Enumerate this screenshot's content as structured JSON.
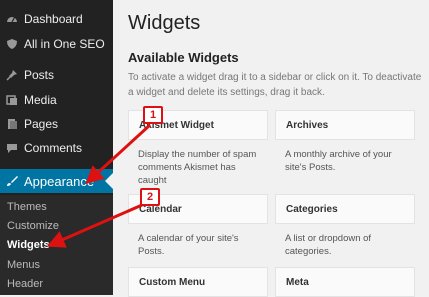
{
  "sidebar": {
    "items": [
      {
        "label": "Dashboard",
        "icon": "dashboard-icon"
      },
      {
        "label": "All in One SEO",
        "icon": "shield-icon"
      },
      {
        "label": "Posts",
        "icon": "pin-icon"
      },
      {
        "label": "Media",
        "icon": "media-icon"
      },
      {
        "label": "Pages",
        "icon": "pages-icon"
      },
      {
        "label": "Comments",
        "icon": "comments-icon"
      },
      {
        "label": "Appearance",
        "icon": "brush-icon"
      }
    ],
    "submenu": [
      "Themes",
      "Customize",
      "Widgets",
      "Menus",
      "Header"
    ],
    "active_color": "#0074a2"
  },
  "main": {
    "title": "Widgets",
    "section_title": "Available Widgets",
    "description": "To activate a widget drag it to a sidebar or click on it. To deactivate a widget and delete its settings, drag it back."
  },
  "widgets": [
    {
      "title": "Akismet Widget",
      "description": "Display the number of spam comments Akismet has caught"
    },
    {
      "title": "Archives",
      "description": "A monthly archive of your site's Posts."
    },
    {
      "title": "Calendar",
      "description": "A calendar of your site's Posts."
    },
    {
      "title": "Categories",
      "description": "A list or dropdown of categories."
    },
    {
      "title": "Custom Menu",
      "description": ""
    },
    {
      "title": "Meta",
      "description": ""
    }
  ],
  "annotations": {
    "badge1": "1",
    "badge2": "2",
    "color": "#dd1111"
  }
}
